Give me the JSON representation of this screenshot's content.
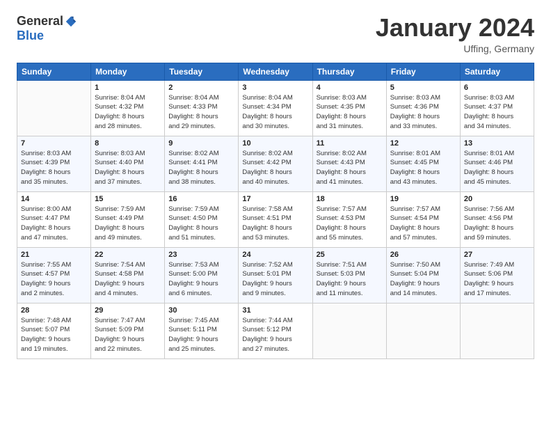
{
  "header": {
    "logo_general": "General",
    "logo_blue": "Blue",
    "title": "January 2024",
    "location": "Uffing, Germany"
  },
  "columns": [
    "Sunday",
    "Monday",
    "Tuesday",
    "Wednesday",
    "Thursday",
    "Friday",
    "Saturday"
  ],
  "weeks": [
    [
      {
        "day": "",
        "sunrise": "",
        "sunset": "",
        "daylight": ""
      },
      {
        "day": "1",
        "sunrise": "Sunrise: 8:04 AM",
        "sunset": "Sunset: 4:32 PM",
        "daylight": "Daylight: 8 hours and 28 minutes."
      },
      {
        "day": "2",
        "sunrise": "Sunrise: 8:04 AM",
        "sunset": "Sunset: 4:33 PM",
        "daylight": "Daylight: 8 hours and 29 minutes."
      },
      {
        "day": "3",
        "sunrise": "Sunrise: 8:04 AM",
        "sunset": "Sunset: 4:34 PM",
        "daylight": "Daylight: 8 hours and 30 minutes."
      },
      {
        "day": "4",
        "sunrise": "Sunrise: 8:03 AM",
        "sunset": "Sunset: 4:35 PM",
        "daylight": "Daylight: 8 hours and 31 minutes."
      },
      {
        "day": "5",
        "sunrise": "Sunrise: 8:03 AM",
        "sunset": "Sunset: 4:36 PM",
        "daylight": "Daylight: 8 hours and 33 minutes."
      },
      {
        "day": "6",
        "sunrise": "Sunrise: 8:03 AM",
        "sunset": "Sunset: 4:37 PM",
        "daylight": "Daylight: 8 hours and 34 minutes."
      }
    ],
    [
      {
        "day": "7",
        "sunrise": "Sunrise: 8:03 AM",
        "sunset": "Sunset: 4:39 PM",
        "daylight": "Daylight: 8 hours and 35 minutes."
      },
      {
        "day": "8",
        "sunrise": "Sunrise: 8:03 AM",
        "sunset": "Sunset: 4:40 PM",
        "daylight": "Daylight: 8 hours and 37 minutes."
      },
      {
        "day": "9",
        "sunrise": "Sunrise: 8:02 AM",
        "sunset": "Sunset: 4:41 PM",
        "daylight": "Daylight: 8 hours and 38 minutes."
      },
      {
        "day": "10",
        "sunrise": "Sunrise: 8:02 AM",
        "sunset": "Sunset: 4:42 PM",
        "daylight": "Daylight: 8 hours and 40 minutes."
      },
      {
        "day": "11",
        "sunrise": "Sunrise: 8:02 AM",
        "sunset": "Sunset: 4:43 PM",
        "daylight": "Daylight: 8 hours and 41 minutes."
      },
      {
        "day": "12",
        "sunrise": "Sunrise: 8:01 AM",
        "sunset": "Sunset: 4:45 PM",
        "daylight": "Daylight: 8 hours and 43 minutes."
      },
      {
        "day": "13",
        "sunrise": "Sunrise: 8:01 AM",
        "sunset": "Sunset: 4:46 PM",
        "daylight": "Daylight: 8 hours and 45 minutes."
      }
    ],
    [
      {
        "day": "14",
        "sunrise": "Sunrise: 8:00 AM",
        "sunset": "Sunset: 4:47 PM",
        "daylight": "Daylight: 8 hours and 47 minutes."
      },
      {
        "day": "15",
        "sunrise": "Sunrise: 7:59 AM",
        "sunset": "Sunset: 4:49 PM",
        "daylight": "Daylight: 8 hours and 49 minutes."
      },
      {
        "day": "16",
        "sunrise": "Sunrise: 7:59 AM",
        "sunset": "Sunset: 4:50 PM",
        "daylight": "Daylight: 8 hours and 51 minutes."
      },
      {
        "day": "17",
        "sunrise": "Sunrise: 7:58 AM",
        "sunset": "Sunset: 4:51 PM",
        "daylight": "Daylight: 8 hours and 53 minutes."
      },
      {
        "day": "18",
        "sunrise": "Sunrise: 7:57 AM",
        "sunset": "Sunset: 4:53 PM",
        "daylight": "Daylight: 8 hours and 55 minutes."
      },
      {
        "day": "19",
        "sunrise": "Sunrise: 7:57 AM",
        "sunset": "Sunset: 4:54 PM",
        "daylight": "Daylight: 8 hours and 57 minutes."
      },
      {
        "day": "20",
        "sunrise": "Sunrise: 7:56 AM",
        "sunset": "Sunset: 4:56 PM",
        "daylight": "Daylight: 8 hours and 59 minutes."
      }
    ],
    [
      {
        "day": "21",
        "sunrise": "Sunrise: 7:55 AM",
        "sunset": "Sunset: 4:57 PM",
        "daylight": "Daylight: 9 hours and 2 minutes."
      },
      {
        "day": "22",
        "sunrise": "Sunrise: 7:54 AM",
        "sunset": "Sunset: 4:58 PM",
        "daylight": "Daylight: 9 hours and 4 minutes."
      },
      {
        "day": "23",
        "sunrise": "Sunrise: 7:53 AM",
        "sunset": "Sunset: 5:00 PM",
        "daylight": "Daylight: 9 hours and 6 minutes."
      },
      {
        "day": "24",
        "sunrise": "Sunrise: 7:52 AM",
        "sunset": "Sunset: 5:01 PM",
        "daylight": "Daylight: 9 hours and 9 minutes."
      },
      {
        "day": "25",
        "sunrise": "Sunrise: 7:51 AM",
        "sunset": "Sunset: 5:03 PM",
        "daylight": "Daylight: 9 hours and 11 minutes."
      },
      {
        "day": "26",
        "sunrise": "Sunrise: 7:50 AM",
        "sunset": "Sunset: 5:04 PM",
        "daylight": "Daylight: 9 hours and 14 minutes."
      },
      {
        "day": "27",
        "sunrise": "Sunrise: 7:49 AM",
        "sunset": "Sunset: 5:06 PM",
        "daylight": "Daylight: 9 hours and 17 minutes."
      }
    ],
    [
      {
        "day": "28",
        "sunrise": "Sunrise: 7:48 AM",
        "sunset": "Sunset: 5:07 PM",
        "daylight": "Daylight: 9 hours and 19 minutes."
      },
      {
        "day": "29",
        "sunrise": "Sunrise: 7:47 AM",
        "sunset": "Sunset: 5:09 PM",
        "daylight": "Daylight: 9 hours and 22 minutes."
      },
      {
        "day": "30",
        "sunrise": "Sunrise: 7:45 AM",
        "sunset": "Sunset: 5:11 PM",
        "daylight": "Daylight: 9 hours and 25 minutes."
      },
      {
        "day": "31",
        "sunrise": "Sunrise: 7:44 AM",
        "sunset": "Sunset: 5:12 PM",
        "daylight": "Daylight: 9 hours and 27 minutes."
      },
      {
        "day": "",
        "sunrise": "",
        "sunset": "",
        "daylight": ""
      },
      {
        "day": "",
        "sunrise": "",
        "sunset": "",
        "daylight": ""
      },
      {
        "day": "",
        "sunrise": "",
        "sunset": "",
        "daylight": ""
      }
    ]
  ]
}
